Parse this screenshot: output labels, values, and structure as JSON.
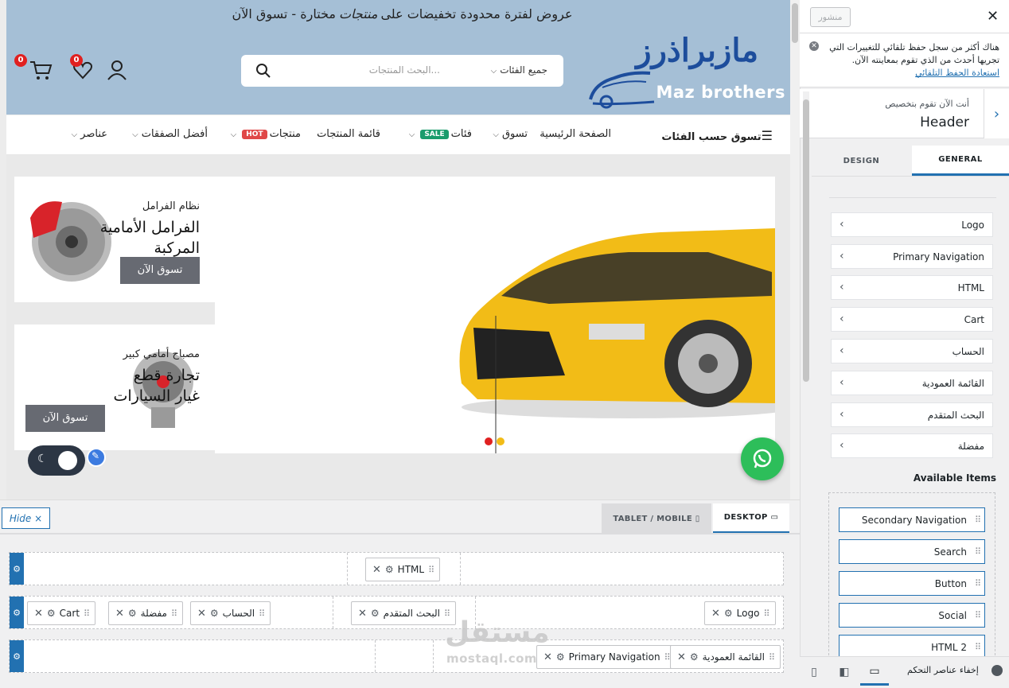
{
  "site": {
    "promo_text": "عروض لفترة محدودة تخفيضات على",
    "promo_highlight": "منتجات",
    "promo_tail": "مختارة - تسوق الآن",
    "logo_ar": "مازبراذرز",
    "logo_en": "Maz brothers",
    "search": {
      "category_label": "جميع الفئات",
      "placeholder": "البحث المنتجات..."
    },
    "wishlist_count": "0",
    "cart_count": "0",
    "nav": {
      "categories": "تسوق حسب الفئات",
      "items": [
        "الصفحة الرئيسية",
        "تسوق",
        "فئات",
        "قائمة المنتجات",
        "منتجات",
        "أفضل الصفقات",
        "عناصر"
      ],
      "sale_badge": "SALE",
      "hot_badge": "HOT"
    },
    "promos": [
      {
        "sub": "نظام الفرامل",
        "title_line1": "الفرامل الأمامية",
        "title_line2": "المركبة",
        "button": "تسوق الآن"
      },
      {
        "sub": "مصباح أمامي كبير",
        "title_line1": "تجارة قطع",
        "title_line2": "غيار السيارات",
        "button": "تسوق الآن"
      }
    ]
  },
  "builder": {
    "hide_label": "Hide",
    "tabs": [
      "TABLET / MOBILE",
      "DESKTOP"
    ],
    "rows": [
      {
        "items": [
          "HTML"
        ]
      },
      {
        "items": [
          "Cart",
          "مفضلة",
          "الحساب",
          "البحث المتقدم",
          "Logo"
        ]
      },
      {
        "items": [
          "Primary Navigation",
          "القائمة العمودية"
        ]
      }
    ]
  },
  "panel": {
    "publish_label": "منشور",
    "notice_text": "هناك أكثر من سجل حفظ تلقائي للتغييرات التي تجريها أحدث من الذي تقوم بمعاينته الآن.",
    "notice_link": "استعادة الحفظ التلقائي",
    "customizing_label": "أنت الآن تقوم بتخصيص",
    "section_title": "Header",
    "tabs": [
      "DESIGN",
      "GENERAL"
    ],
    "items": [
      "Logo",
      "Primary Navigation",
      "HTML",
      "Cart",
      "الحساب",
      "القائمة العمودية",
      "البحث المتقدم",
      "مفضلة"
    ],
    "available_title": "Available Items",
    "available_items": [
      "Secondary Navigation",
      "Search",
      "Button",
      "Social",
      "HTML 2"
    ],
    "hide_controls": "إخفاء عناصر التحكم"
  },
  "watermark": {
    "ar": "مستقل",
    "en": "mostaql.com"
  },
  "colors": {
    "accent": "#2271b1",
    "header_bg": "#a5bfd6",
    "badge_red": "#e02020",
    "sale_green": "#1a9c6c",
    "hot_red": "#e04848",
    "whatsapp": "#2dbe5a"
  }
}
